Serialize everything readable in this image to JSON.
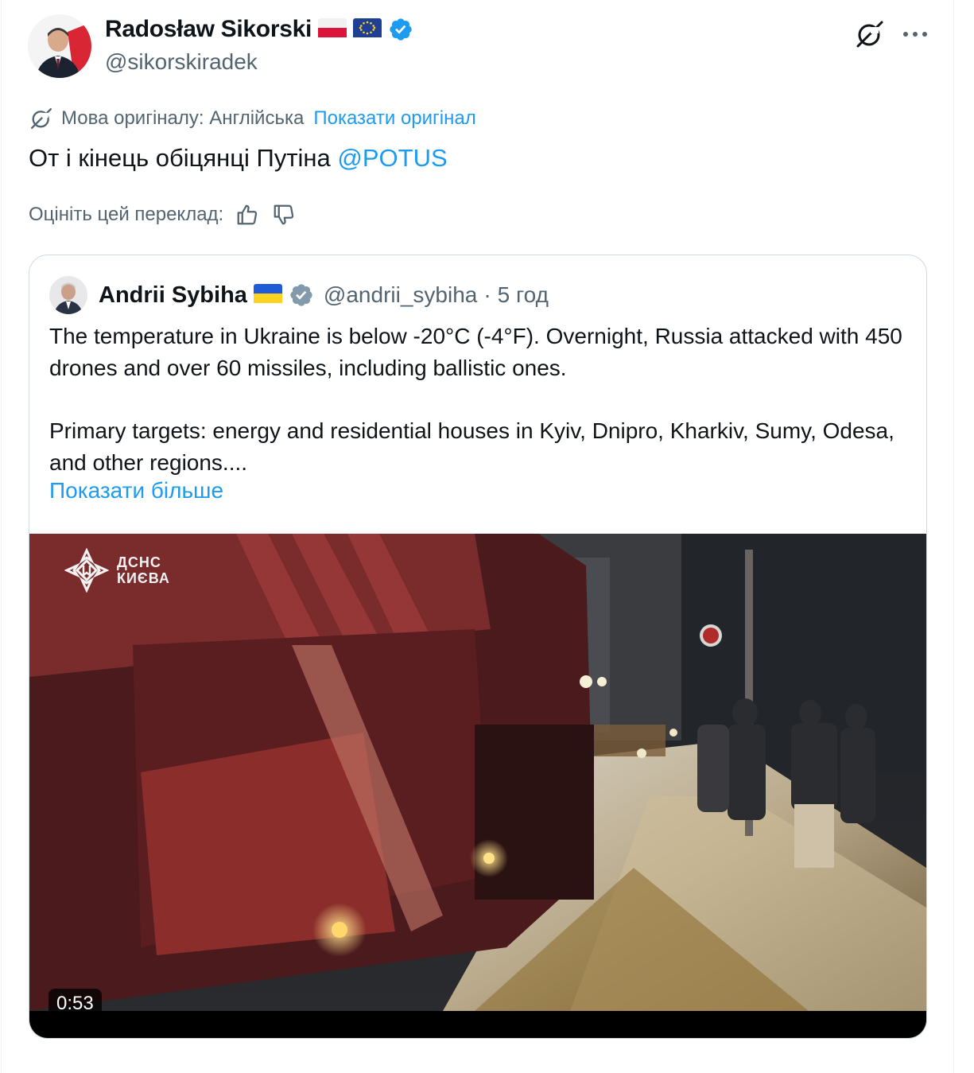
{
  "author": {
    "display_name": "Radosław Sikorski",
    "handle": "@sikorskiradek",
    "flags": [
      "poland-flag",
      "eu-flag"
    ],
    "verified": "verified-badge-blue"
  },
  "translation": {
    "info_label": "Мова оригіналу: Англійська",
    "show_original": "Показати оригінал"
  },
  "tweet": {
    "text": "От і кінець обіцянці Путіна ",
    "mention": "@POTUS"
  },
  "rating": {
    "label": "Оцініть цей переклад:"
  },
  "quote": {
    "display_name": "Andrii Sybiha",
    "flag": "ukraine-flag",
    "handle": "@andrii_sybiha",
    "separator": "·",
    "time": "5 год",
    "paragraph_1": "The temperature in Ukraine is below -20°C (-4°F). Overnight, Russia attacked with 450 drones and over 60 missiles, including ballistic ones.",
    "paragraph_2": "Primary targets: energy and residential houses in Kyiv, Dnipro, Kharkiv, Sumy, Odesa, and other regions....",
    "show_more": "Показати більше",
    "video": {
      "watermark": "ДСНС\nКИЄВА",
      "duration": "0:53"
    }
  },
  "colors": {
    "accent": "#1d9bf0",
    "secondary_text": "#536471",
    "border": "#cfd9de"
  }
}
